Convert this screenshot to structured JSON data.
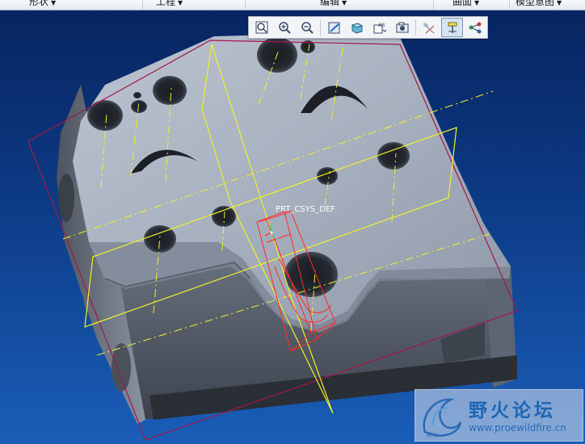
{
  "ribbon": {
    "tabs": [
      "形状",
      "工程",
      "编辑",
      "曲面",
      "模型意图"
    ]
  },
  "view_toolbar": {
    "buttons": [
      {
        "icon": "zoom-fit-icon"
      },
      {
        "icon": "zoom-in-icon"
      },
      {
        "icon": "zoom-out-icon"
      },
      {
        "icon": "repaint-icon"
      },
      {
        "icon": "display-style-icon"
      },
      {
        "icon": "saved-views-icon"
      },
      {
        "icon": "section-view-icon"
      },
      {
        "icon": "datum-display-icon"
      },
      {
        "icon": "spin-center-icon",
        "active": true
      },
      {
        "icon": "annotation-display-icon"
      }
    ]
  },
  "model": {
    "csys_label": "PRT_CSYS_DEF"
  },
  "watermark": {
    "name": "野火论坛",
    "url": "www.proewildfire.cn"
  }
}
